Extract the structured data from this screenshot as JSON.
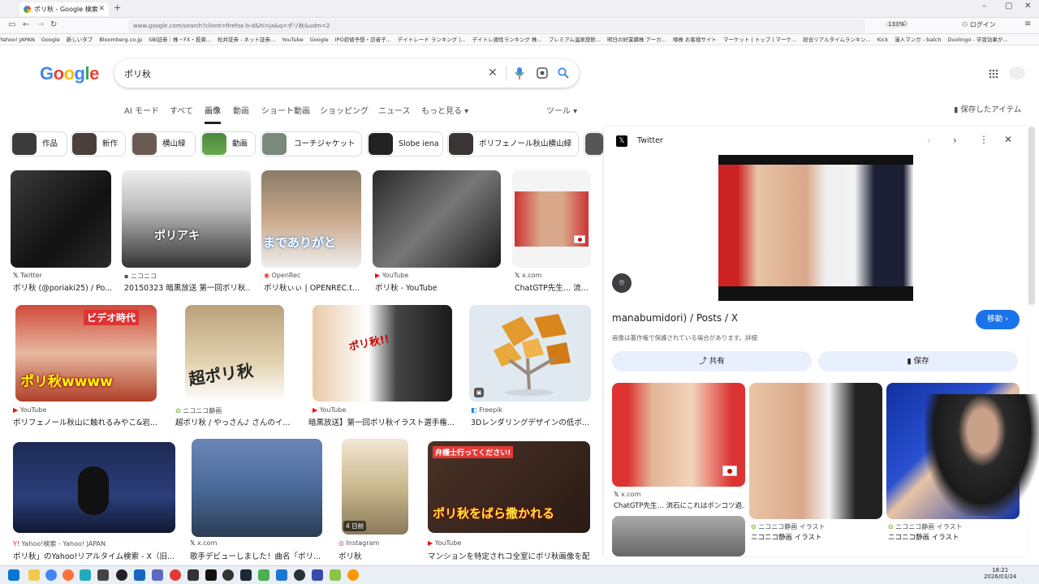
{
  "browser": {
    "tab_title": "ポリ秋 - Google 検索",
    "url": "www.google.com/search?client=firefox-b-d&hl=ja&q=ポリ秋&udm=2",
    "zoom": "133%",
    "bookmarks": [
      "Yahoo! JAPAN",
      "Google",
      "新しいタブ",
      "Bloomberg.co.jp",
      "SBI証券｜株・FX・投資...",
      "松井証券 - ネット証券...",
      "YouTube",
      "Google",
      "IPO初値予想・訪者子...",
      "デイトレード ランキング |...",
      "デイトレ適性ランキング 株...",
      "プレミアム温泉旅館...",
      "明日の好業績株 アーカ...",
      "噂株 お客様サイト",
      "マーケット | トップ | マーケ...",
      "総合リアルタイムランキン...",
      "Kick",
      "漫人マンガ - batch",
      "Duolingo - 学習効果が..."
    ]
  },
  "google": {
    "logo": "Google",
    "query": "ポリ秋",
    "tabs": [
      "AI モード",
      "すべて",
      "画像",
      "動画",
      "ショート動画",
      "ショッピング",
      "ニュース",
      "もっと見る ▾"
    ],
    "tools": "ツール ▾",
    "saved": "保存したアイテム",
    "chips": [
      "作品",
      "新作",
      "横山緑",
      "動画",
      "コーチジャケット",
      "Slobe iena",
      "ポリフェノール秋山横山緑"
    ]
  },
  "results": [
    {
      "source": "Twitter",
      "title": "ポリ秋 (@poriaki25) / Po..."
    },
    {
      "source": "ニコニコ",
      "title": "20150323 暗黒放送 第一回ポリ秋..."
    },
    {
      "source": "OpenRec",
      "title": "ポリ秋ぃぃ | OPENREC.t..."
    },
    {
      "source": "YouTube",
      "title": "ポリ秋 - YouTube"
    },
    {
      "source": "x.com",
      "title": "ChatGTP先生… 流..."
    },
    {
      "source": "YouTube",
      "title": "ポリフェノール秋山に触れるみやこ&岩..."
    },
    {
      "source": "ニコニコ静画",
      "title": "超ポリ秋 / やっさん♪ さんのイ..."
    },
    {
      "source": "YouTube",
      "title": "暗黒放送】第一回ポリ秋イラスト選手権..."
    },
    {
      "source": "Freepik",
      "title": "3Dレンダリングデザインの低ポ..."
    },
    {
      "source": "Yahoo!検索 - Yahoo! JAPAN",
      "title": "ポリ秋」のYahoo!リアルタイム検索 - X（旧..."
    },
    {
      "source": "x.com",
      "title": "歌手デビューしました！曲名「ポリ..."
    },
    {
      "source": "Instagram",
      "title": "ポリ秋"
    },
    {
      "source": "YouTube",
      "title": "マンションを特定されコ全室にポリ秋画像を配..."
    }
  ],
  "overlay_text": {
    "r2": "ポリアキ",
    "r3": "までありがと",
    "r5_badge": "ビデオ時代",
    "r5_main": "ポリ秋wwww",
    "r6": "超ポリ秋",
    "r7": "ポリ秋!!",
    "r11_badge": "4 日前",
    "r12": "ポリ秋をばら撒かれる",
    "r12_top": "弁護士行ってください!"
  },
  "panel": {
    "site": "Twitter",
    "title": "manabumidori) / Posts / X",
    "visit": "移動 ›",
    "notice": "画像は著作権で保護されている場合があります。詳細",
    "share": "共有",
    "save": "保存",
    "related": [
      {
        "source": "x.com",
        "title": "ChatGTP先生… 流石にこれはポンコツ過..."
      },
      {
        "source": "ニコニコ静画 イラスト",
        "title": "ニコニコ静画 イラスト"
      },
      {
        "source": "ニコニコ静画 イラスト",
        "title": "ニコニコ静画 イラスト"
      }
    ]
  },
  "taskbar": {
    "time": "18:21",
    "date": "2026/03/24"
  }
}
